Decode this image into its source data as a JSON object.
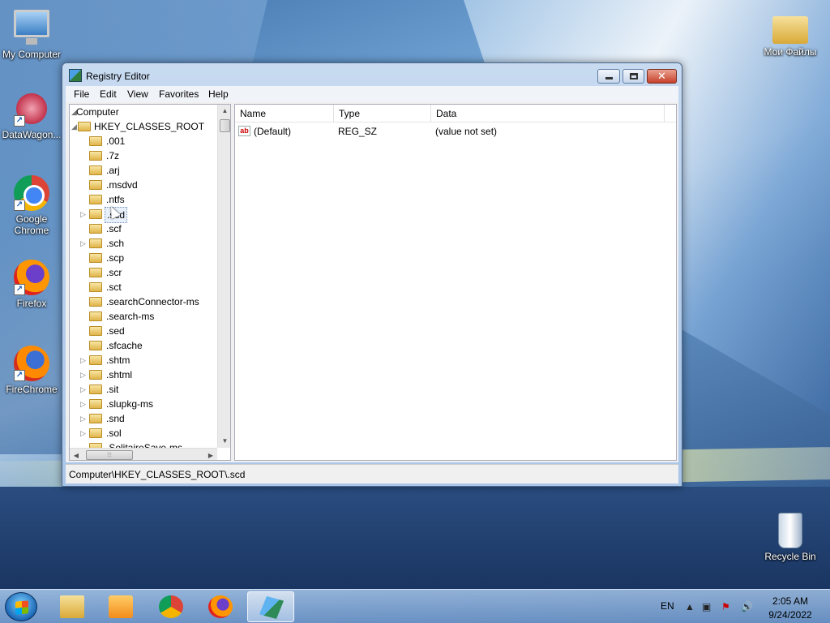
{
  "desktop": {
    "icons": [
      {
        "label": "My Computer"
      },
      {
        "label": "DataWagon..."
      },
      {
        "label": "Google Chrome"
      },
      {
        "label": "Firefox"
      },
      {
        "label": "FireChrome"
      },
      {
        "label": "Мои Файлы"
      },
      {
        "label": "Recycle Bin"
      }
    ]
  },
  "window": {
    "title": "Registry Editor",
    "close_glyph": "✕",
    "menu": [
      "File",
      "Edit",
      "View",
      "Favorites",
      "Help"
    ],
    "tree": {
      "root": "Computer",
      "hive": "HKEY_CLASSES_ROOT",
      "keys": [
        ".001",
        ".7z",
        ".arj",
        ".msdvd",
        ".ntfs",
        ".scd",
        ".scf",
        ".sch",
        ".scp",
        ".scr",
        ".sct",
        ".searchConnector-ms",
        ".search-ms",
        ".sed",
        ".sfcache",
        ".shtm",
        ".shtml",
        ".sit",
        ".slupkg-ms",
        ".snd",
        ".sol",
        ".SolitaireSave-ms"
      ],
      "selected": ".scd"
    },
    "list": {
      "columns": [
        "Name",
        "Type",
        "Data"
      ],
      "rows": [
        {
          "icon": "ab",
          "name": "(Default)",
          "type": "REG_SZ",
          "data": "(value not set)"
        }
      ]
    },
    "status": "Computer\\HKEY_CLASSES_ROOT\\.scd"
  },
  "taskbar": {
    "language": "EN",
    "time": "2:05 AM",
    "date": "9/24/2022",
    "apps": [
      "windows-explorer-icon",
      "media-player-icon",
      "chrome-icon",
      "firefox-icon",
      "regedit-icon"
    ]
  }
}
